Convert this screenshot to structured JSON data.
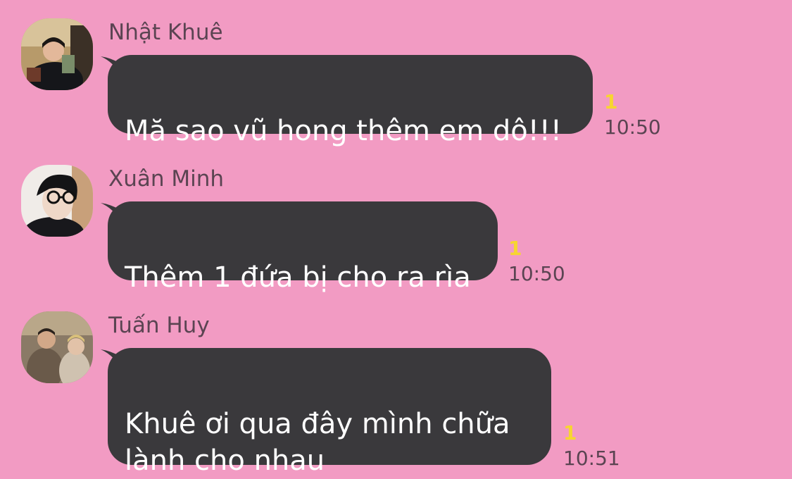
{
  "messages": [
    {
      "sender": "Nhật Khuê",
      "text": "Mă sao vũ hong thêm em dô!!!",
      "unread": "1",
      "time": "10:50"
    },
    {
      "sender": "Xuân Minh",
      "text": "Thêm 1 đứa bị cho ra rìa",
      "unread": "1",
      "time": "10:50"
    },
    {
      "sender": "Tuấn Huy",
      "text": "Khuê ơi qua đây mình chữa\nlành cho nhau",
      "unread": "1",
      "time": "10:51"
    }
  ],
  "colors": {
    "background": "#f29bc3",
    "bubble": "#3a393c",
    "unread": "#f7d531"
  }
}
